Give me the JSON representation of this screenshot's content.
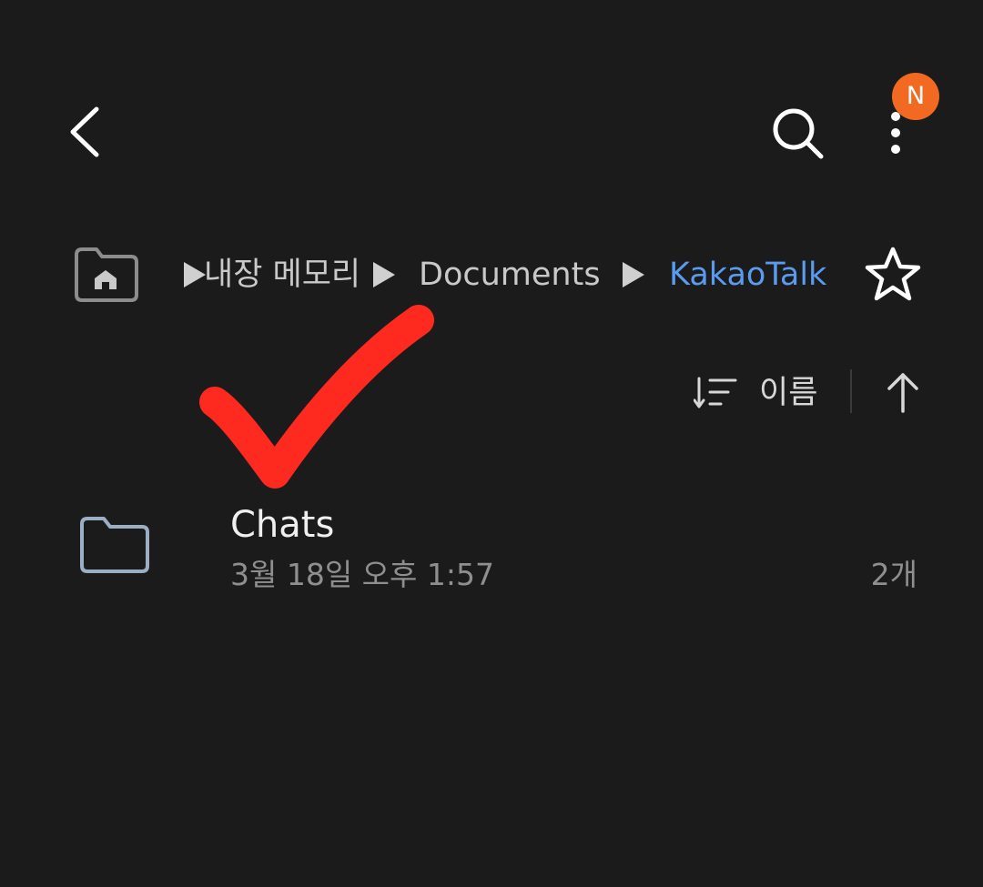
{
  "header": {
    "back_icon": "chevron-left-icon",
    "search_icon": "search-icon",
    "more_icon": "more-vertical-icon",
    "notification_badge": "N",
    "badge_color": "#f26a21"
  },
  "breadcrumb": {
    "home_icon": "home-folder-icon",
    "items": [
      {
        "label": "내장 메모리"
      },
      {
        "label": "Documents"
      },
      {
        "label": "KakaoTalk"
      }
    ],
    "current_color": "#5a9bef",
    "favorite_icon": "star-outline-icon"
  },
  "sort": {
    "icon": "sort-icon",
    "label": "이름",
    "direction_icon": "arrow-up-icon"
  },
  "files": [
    {
      "name": "Chats",
      "modified": "3월 18일 오후 1:57",
      "count": "2개",
      "icon": "folder-icon"
    }
  ],
  "annotation": {
    "type": "checkmark",
    "color": "#ff2a1f"
  }
}
